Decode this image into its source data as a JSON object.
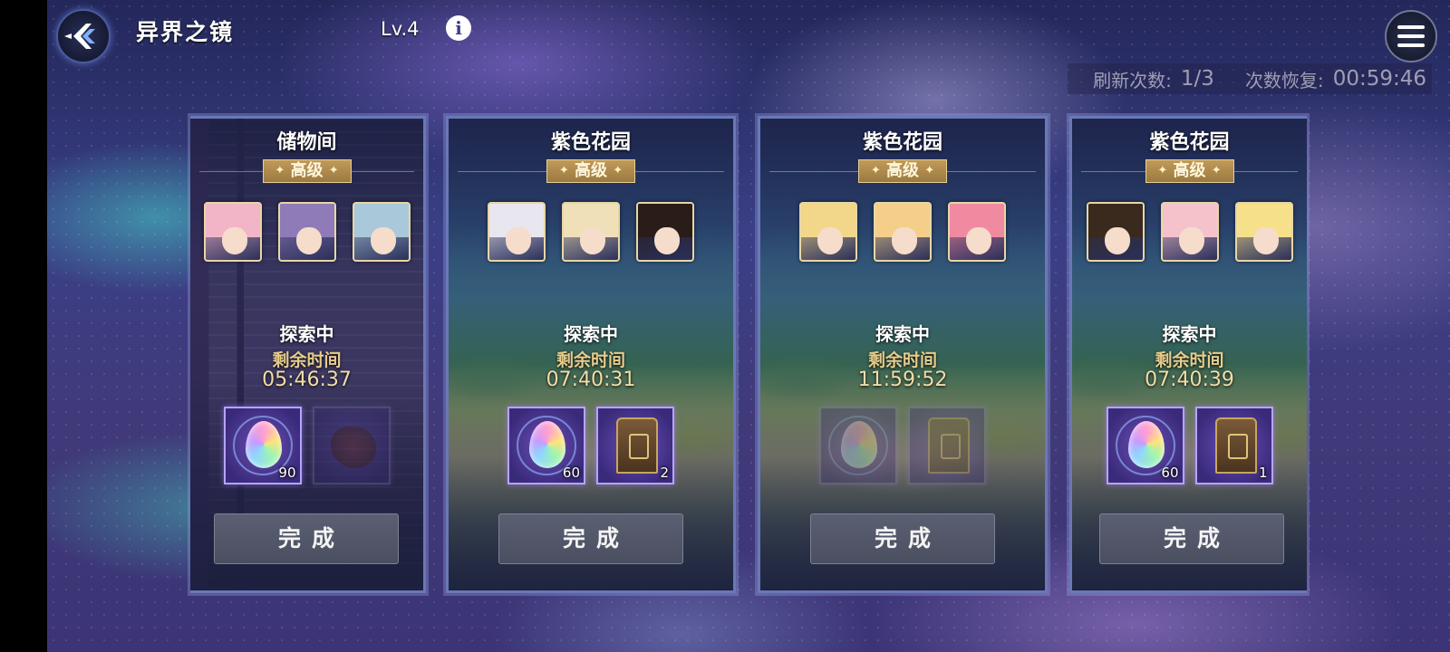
{
  "header": {
    "title": "异界之镜",
    "level": "Lv.4",
    "info_icon": "info-icon",
    "menu_icon": "hamburger-menu-icon",
    "back_icon": "back-arrow-icon"
  },
  "refresh": {
    "count_label": "刷新次数:",
    "count_value": "1/3",
    "recover_label": "次数恢复:",
    "recover_value": "00:59:46"
  },
  "cards": [
    {
      "title": "储物间",
      "grade": "高级",
      "scene": "store",
      "portrait_colors": [
        "#f2b5c8",
        "#8f7bb8",
        "#a9c8d9"
      ],
      "status": "探索中",
      "remain_label": "剩余时间",
      "remain_time": "05:46:37",
      "rewards": [
        {
          "icon": "rainbow-crystal-icon",
          "kind": "gem",
          "qty": "90",
          "dim": false
        },
        {
          "icon": "ore-icon",
          "kind": "ore",
          "qty": "",
          "dim": true
        }
      ],
      "button": "完成"
    },
    {
      "title": "紫色花园",
      "grade": "高级",
      "scene": "garden",
      "portrait_colors": [
        "#e8e6ee",
        "#f0e0b8",
        "#2a1c18"
      ],
      "status": "探索中",
      "remain_label": "剩余时间",
      "remain_time": "07:40:31",
      "rewards": [
        {
          "icon": "rainbow-crystal-icon",
          "kind": "gem",
          "qty": "60",
          "dim": false
        },
        {
          "icon": "wardrobe-icon",
          "kind": "chest",
          "qty": "2",
          "dim": false
        }
      ],
      "button": "完成"
    },
    {
      "title": "紫色花园",
      "grade": "高级",
      "scene": "garden",
      "portrait_colors": [
        "#f2d78a",
        "#f5cf8a",
        "#f08aa0"
      ],
      "status": "探索中",
      "remain_label": "剩余时间",
      "remain_time": "11:59:52",
      "rewards": [
        {
          "icon": "rainbow-crystal-icon",
          "kind": "gem",
          "qty": "",
          "dim": true
        },
        {
          "icon": "wardrobe-icon",
          "kind": "chest",
          "qty": "",
          "dim": true
        }
      ],
      "button": "完成"
    },
    {
      "title": "紫色花园",
      "grade": "高级",
      "scene": "garden",
      "portrait_colors": [
        "#3a2a1e",
        "#f5c2cc",
        "#f6e08a"
      ],
      "status": "探索中",
      "remain_label": "剩余时间",
      "remain_time": "07:40:39",
      "rewards": [
        {
          "icon": "rainbow-crystal-icon",
          "kind": "gem",
          "qty": "60",
          "dim": false
        },
        {
          "icon": "wardrobe-icon",
          "kind": "chest",
          "qty": "1",
          "dim": false
        }
      ],
      "button": "完成"
    }
  ]
}
